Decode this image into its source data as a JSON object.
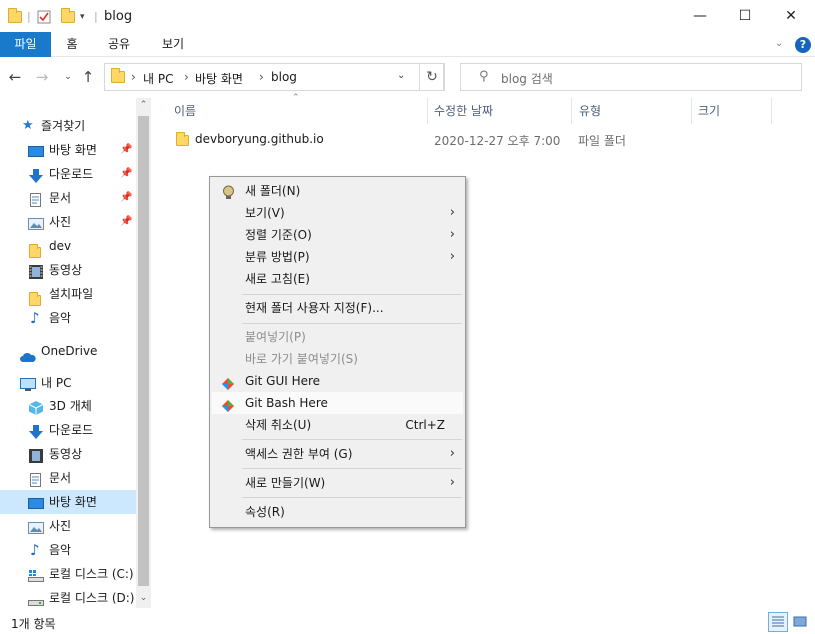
{
  "window": {
    "title": "blog",
    "controls": {
      "minimize": "—",
      "maximize": "☐",
      "close": "✕"
    }
  },
  "ribbon": {
    "tabs": [
      "파일",
      "홈",
      "공유",
      "보기"
    ],
    "help": "?"
  },
  "address": {
    "path": [
      "내 PC",
      "바탕 화면",
      "blog"
    ],
    "search_placeholder": "blog 검색"
  },
  "sidebar": {
    "quick_access": "즐겨찾기",
    "items": [
      {
        "label": "바탕 화면",
        "icon": "desktop-icon",
        "pinned": true
      },
      {
        "label": "다운로드",
        "icon": "download-icon",
        "pinned": true
      },
      {
        "label": "문서",
        "icon": "document-icon",
        "pinned": true
      },
      {
        "label": "사진",
        "icon": "picture-icon",
        "pinned": true
      },
      {
        "label": "dev",
        "icon": "folder-icon",
        "pinned": false
      },
      {
        "label": "동영상",
        "icon": "video-icon",
        "pinned": false
      },
      {
        "label": "설치파일",
        "icon": "folder-icon",
        "pinned": false
      },
      {
        "label": "음악",
        "icon": "music-icon",
        "pinned": false
      }
    ],
    "onedrive": "OneDrive",
    "this_pc": "내 PC",
    "pc_items": [
      {
        "label": "3D 개체",
        "icon": "cube-icon"
      },
      {
        "label": "다운로드",
        "icon": "download-icon"
      },
      {
        "label": "동영상",
        "icon": "video-icon"
      },
      {
        "label": "문서",
        "icon": "document-icon"
      },
      {
        "label": "바탕 화면",
        "icon": "desktop-icon",
        "selected": true
      },
      {
        "label": "사진",
        "icon": "picture-icon"
      },
      {
        "label": "음악",
        "icon": "music-icon"
      },
      {
        "label": "로컬 디스크 (C:)",
        "icon": "drive-c-icon"
      },
      {
        "label": "로컬 디스크 (D:)",
        "icon": "drive-icon"
      }
    ]
  },
  "content": {
    "columns": [
      "이름",
      "수정한 날짜",
      "유형",
      "크기"
    ],
    "rows": [
      {
        "name": "devboryung.github.io",
        "modified": "2020-12-27 오후 7:00",
        "type": "파일 폴더",
        "size": ""
      }
    ]
  },
  "context_menu": {
    "new_folder": "새 폴더(N)",
    "view": "보기(V)",
    "sort_by": "정렬 기준(O)",
    "group_by": "분류 방법(P)",
    "refresh": "새로 고침(E)",
    "customize": "현재 폴더 사용자 지정(F)...",
    "paste": "붙여넣기(P)",
    "paste_shortcut": "바로 가기 붙여넣기(S)",
    "git_gui": "Git GUI Here",
    "git_bash": "Git Bash Here",
    "undo_delete": "삭제 취소(U)",
    "undo_shortcut": "Ctrl+Z",
    "give_access": "액세스 권한 부여 (G)",
    "new": "새로 만들기(W)",
    "properties": "속성(R)"
  },
  "status": {
    "item_count": "1개 항목"
  },
  "colors": {
    "accent": "#1979ca",
    "folder": "#ffd766",
    "selection": "#cce8ff"
  }
}
